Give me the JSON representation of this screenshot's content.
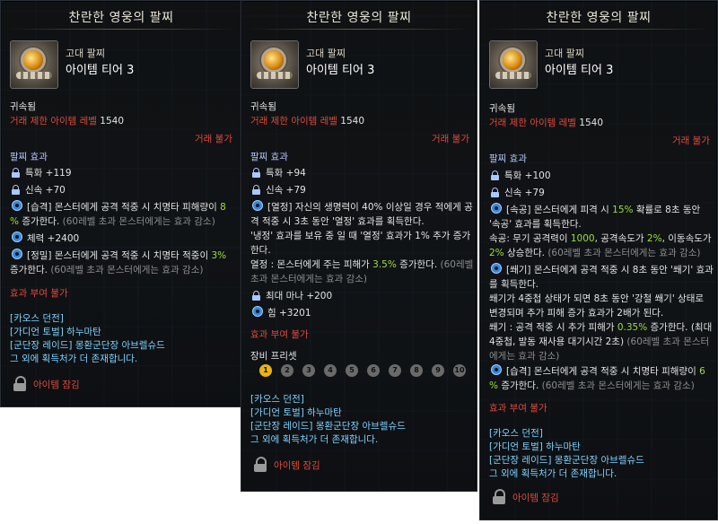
{
  "common": {
    "item_title": "찬란한 영웅의 팔찌",
    "grade": "고대 팔찌",
    "tier": "아이템 티어 3",
    "bound": "귀속됨",
    "trade_level_label": "거래 제한 아이템 레벨",
    "trade_level_value": "1540",
    "no_trade": "거래 불가",
    "bracelet_effects": "팔찌 효과",
    "no_effect_grant": "효과 부여 불가",
    "source_chaos": "[카오스 던전]",
    "source_guardian": "[가디언 토벌] 하누마탄",
    "source_raid": "[군단장 레이드] 몽환군단장 아브렐슈드",
    "source_more": "그 외에 획득처가 더 존재합니다.",
    "item_locked": "아이템 잠김"
  },
  "tooltip1": {
    "stat1": "특화 +119",
    "stat2": "신속 +70",
    "eff1_tag": "[습격]",
    "eff1_text": " 몬스터에게 공격 적중 시 치명타 피해량이 ",
    "eff1_val": "8",
    "eff1_l2_val": "%",
    "eff1_l2_text": " 증가한다.",
    "eff1_note": " (60레벨 초과 몬스터에게는 효과 감소)",
    "stat3": "체력 +2400",
    "eff2_tag": "[정밀]",
    "eff2_text": " 몬스터에게 공격 적중 시 치명타 적중이 ",
    "eff2_val": "3%",
    "eff2_l2_text": "증가한다.",
    "eff2_note": " (60레벨 초과 몬스터에게는 효과 감소)"
  },
  "tooltip2": {
    "eff1_tag": "[열정]",
    "eff1_l1": " 자신의 생명력이 40% 이상일 경우 적에게 공",
    "eff1_l2": "격 적중 시 3초 동안 '열정' 효과를 획득한다.",
    "eff1_l3": "'냉정' 효과를 보유 중 일 때 '열정' 효과가 1% 추가 증가",
    "eff1_l4": "한다.",
    "eff1_l5a": "열정 : 몬스터에게 주는 피해가 ",
    "eff1_l5v": "3.5%",
    "eff1_l5b": " 증가한다.",
    "eff1_l5c": " (60레벨",
    "eff1_l6": "초과 몬스터에게는 효과 감소)",
    "stat1": "특화 +94",
    "stat2": "신속 +79",
    "stat3": "최대 마나 +200",
    "stat4": "힘 +3201",
    "preset_label": "장비 프리셋",
    "presets": [
      "1",
      "2",
      "3",
      "4",
      "5",
      "6",
      "7",
      "8",
      "9",
      "10"
    ],
    "active_preset": "1"
  },
  "tooltip3": {
    "stat1": "특화 +100",
    "stat2": "신속 +79",
    "eff1_tag": "[속공]",
    "eff1_l1": " 몬스터에게 피격 시 ",
    "eff1_l1v": "15%",
    "eff1_l1b": " 확률로 8초 동안",
    "eff1_l2": "'속공' 효과를 획득한다.",
    "eff1_l3a": "속공: 무기 공격력이 ",
    "eff1_l3v": "1000",
    "eff1_l3b": ", 공격속도가 ",
    "eff1_l3v2": "2%",
    "eff1_l3c": ", 이동속도가",
    "eff1_l4v": "2%",
    "eff1_l4b": " 상승한다.",
    "eff1_l4c": " (60레벨 초과 몬스터에게는 효과 감소)",
    "eff2_tag": "[쐐기]",
    "eff2_l1": " 몬스터에게 공격 적중 시 8초 동안 '쐐기' 효과",
    "eff2_l2": "를 획득한다.",
    "eff2_l3": "쐐기가 4중첩 상태가 되면 8초 동안 '강철 쐐기' 상태로",
    "eff2_l4": "변경되며 추가 피해 증가 효과가 2배가 된다.",
    "eff2_l5a": "쐐기 : 공격 적중 시 추가 피해가 ",
    "eff2_l5v": "0.35%",
    "eff2_l5b": " 증가한다. (최대",
    "eff2_l6a": "4중첩, 발동 재사용 대기시간 2초)",
    "eff2_l6b": " (60레벨 초과 몬스터",
    "eff2_l7": "에게는 효과 감소)",
    "eff3_tag": "[습격]",
    "eff3_text": " 몬스터에게 공격 적중 시 치명타 피해량이 ",
    "eff3_val": "6",
    "eff3_l2a": "%",
    "eff3_l2b": " 증가한다.",
    "eff3_l2c": " (60레벨 초과 몬스터에게는 효과 감소)"
  }
}
